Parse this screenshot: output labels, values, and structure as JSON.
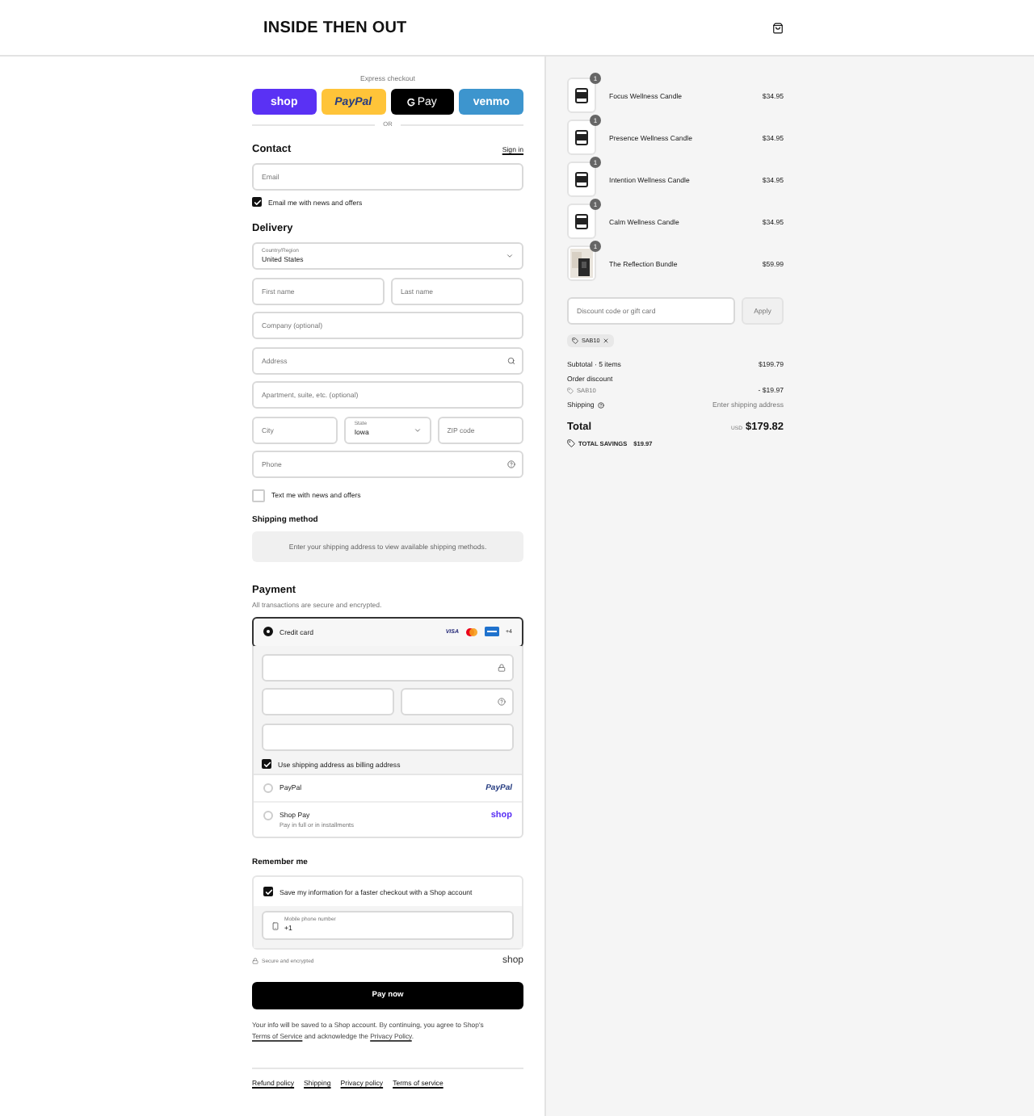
{
  "header": {
    "brand": "INSIDE THEN OUT"
  },
  "express": {
    "label": "Express checkout",
    "divider": "OR",
    "buttons": [
      {
        "kind": "shop",
        "label": "shop"
      },
      {
        "kind": "paypal",
        "label": "PayPal"
      },
      {
        "kind": "gpay",
        "label": "Pay"
      },
      {
        "kind": "venmo",
        "label": "venmo"
      }
    ]
  },
  "contact": {
    "title": "Contact",
    "link": "Sign in",
    "email": {
      "placeholder": "Email"
    },
    "newsletter": {
      "label": "Email me with news and offers",
      "checked": true
    }
  },
  "delivery": {
    "title": "Delivery",
    "rows": [
      [
        {
          "kind": "select",
          "label": "Country/Region",
          "value": "United States"
        }
      ],
      [
        {
          "kind": "input",
          "placeholder": "First name"
        },
        {
          "kind": "input",
          "placeholder": "Last name"
        }
      ],
      [
        {
          "kind": "input",
          "placeholder": "Company (optional)"
        }
      ],
      [
        {
          "kind": "search",
          "placeholder": "Address"
        }
      ],
      [
        {
          "kind": "input",
          "placeholder": "Apartment, suite, etc. (optional)"
        }
      ],
      [
        {
          "kind": "input",
          "placeholder": "City"
        },
        {
          "kind": "select",
          "label": "State",
          "value": "Iowa"
        },
        {
          "kind": "input",
          "placeholder": "ZIP code"
        }
      ],
      [
        {
          "kind": "help",
          "placeholder": "Phone"
        }
      ]
    ],
    "sms": {
      "label": "Text me with news and offers",
      "checked": false
    }
  },
  "shipping": {
    "title": "Shipping method",
    "notice": "Enter your shipping address to view available shipping methods."
  },
  "payment": {
    "title": "Payment",
    "subtitle": "All transactions are secure and encrypted.",
    "card": {
      "label": "Credit card",
      "selected": true,
      "brand_text": "VISA",
      "more": "+4",
      "billing": {
        "label": "Use shipping address as billing address",
        "checked": true
      }
    },
    "others": [
      {
        "kind": "paypal",
        "label": "PayPal",
        "logo": "PayPal",
        "selected": false
      },
      {
        "kind": "shop",
        "label": "Shop Pay",
        "sub": "Pay in full or in installments",
        "logo": "shop",
        "selected": false
      }
    ]
  },
  "remember": {
    "title": "Remember me",
    "save": {
      "label": "Save my information for a faster checkout with a Shop account",
      "checked": true
    },
    "phone": {
      "label": "Mobile phone number",
      "value": "+1"
    },
    "secure": "Secure and encrypted",
    "logo": "shop"
  },
  "pay_button": "Pay now",
  "terms": [
    {
      "kind": "text",
      "text": "Your info will be saved to a Shop account. By continuing, you agree to Shop's "
    },
    {
      "kind": "link",
      "text": "Terms of Service"
    },
    {
      "kind": "text",
      "text": " and acknowledge the "
    },
    {
      "kind": "link",
      "text": "Privacy Policy"
    },
    {
      "kind": "text",
      "text": "."
    }
  ],
  "footer_links": [
    "Refund policy",
    "Shipping",
    "Privacy policy",
    "Terms of service"
  ],
  "summary": {
    "items": [
      {
        "kind": "candle",
        "name": "Focus Wellness Candle",
        "price": "$34.95",
        "quantity": "1"
      },
      {
        "kind": "candle",
        "name": "Presence Wellness Candle",
        "price": "$34.95",
        "quantity": "1"
      },
      {
        "kind": "candle",
        "name": "Intention Wellness Candle",
        "price": "$34.95",
        "quantity": "1"
      },
      {
        "kind": "candle",
        "name": "Calm Wellness Candle",
        "price": "$34.95",
        "quantity": "1"
      },
      {
        "kind": "bundle",
        "name": "The Reflection Bundle",
        "price": "$59.99",
        "quantity": "1"
      }
    ],
    "discount": {
      "placeholder": "Discount code or gift card",
      "button": "Apply"
    },
    "code": "SAB10",
    "subtotal": {
      "label": "Subtotal · 5 items",
      "value": "$199.79"
    },
    "order_discount": {
      "label": "Order discount",
      "code": "SAB10",
      "value": "- $19.97"
    },
    "shipping": {
      "label": "Shipping",
      "value": "Enter shipping address"
    },
    "total": {
      "label": "Total",
      "currency": "USD",
      "value": "$179.82"
    },
    "savings": {
      "label": "TOTAL SAVINGS",
      "value": "$19.97"
    }
  }
}
